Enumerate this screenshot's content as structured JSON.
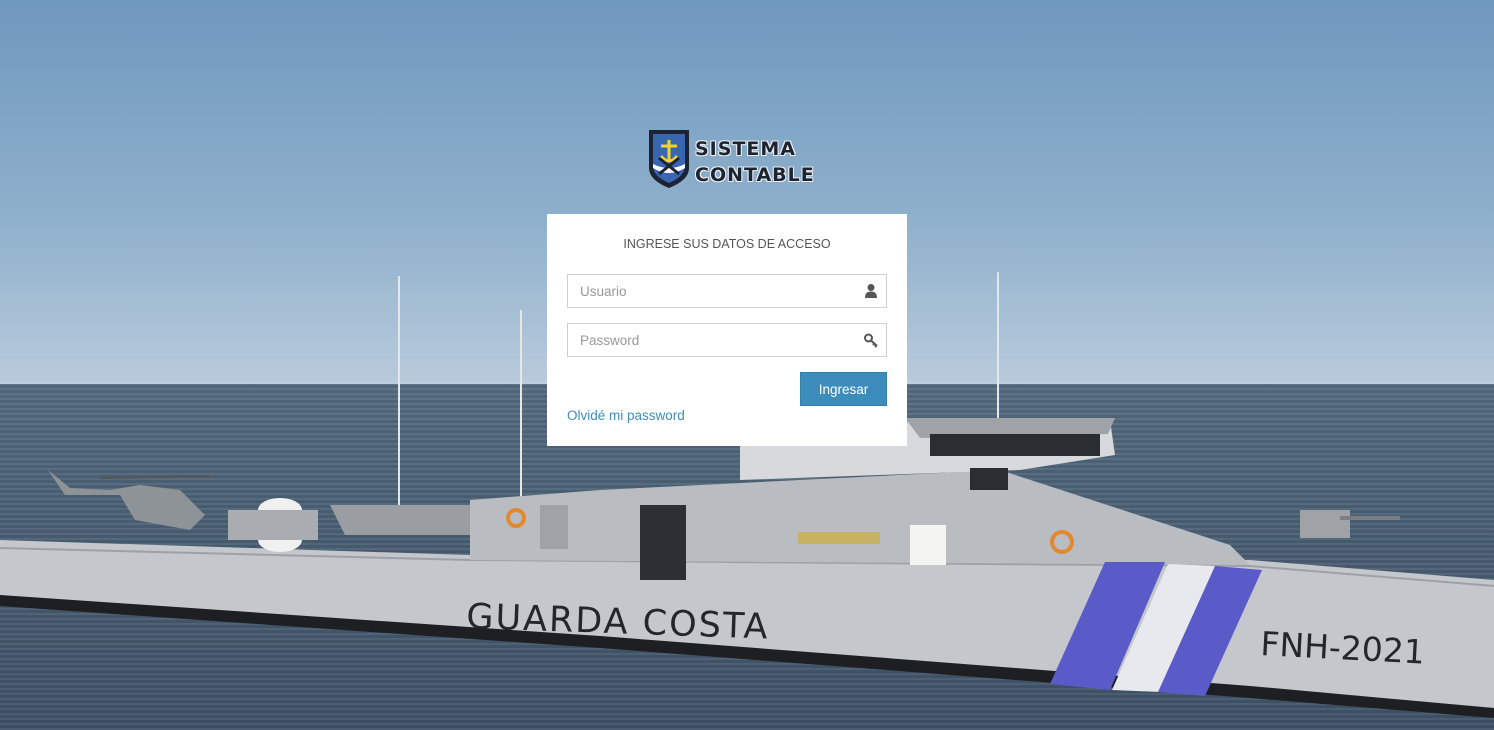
{
  "brand": {
    "line1": "SISTEMA",
    "line2": "CONTABLE",
    "shield_icon": "coast-guard-shield-icon"
  },
  "login": {
    "title": "INGRESE SUS DATOS DE ACCESO",
    "username": {
      "placeholder": "Usuario",
      "value": "",
      "icon": "user-icon"
    },
    "password": {
      "placeholder": "Password",
      "value": "",
      "icon": "key-icon"
    },
    "submit_label": "Ingresar",
    "forgot_label": "Olvidé mi password"
  },
  "background": {
    "hull_text": "GUARDA COSTA",
    "hull_number": "FNH-2021"
  },
  "colors": {
    "primary": "#3c8dbc",
    "panel": "#ffffff",
    "sky": "#7fa4c6",
    "sea": "#4b6075",
    "hull": "#c9ccd0",
    "stripe_blue": "#5656c8"
  }
}
